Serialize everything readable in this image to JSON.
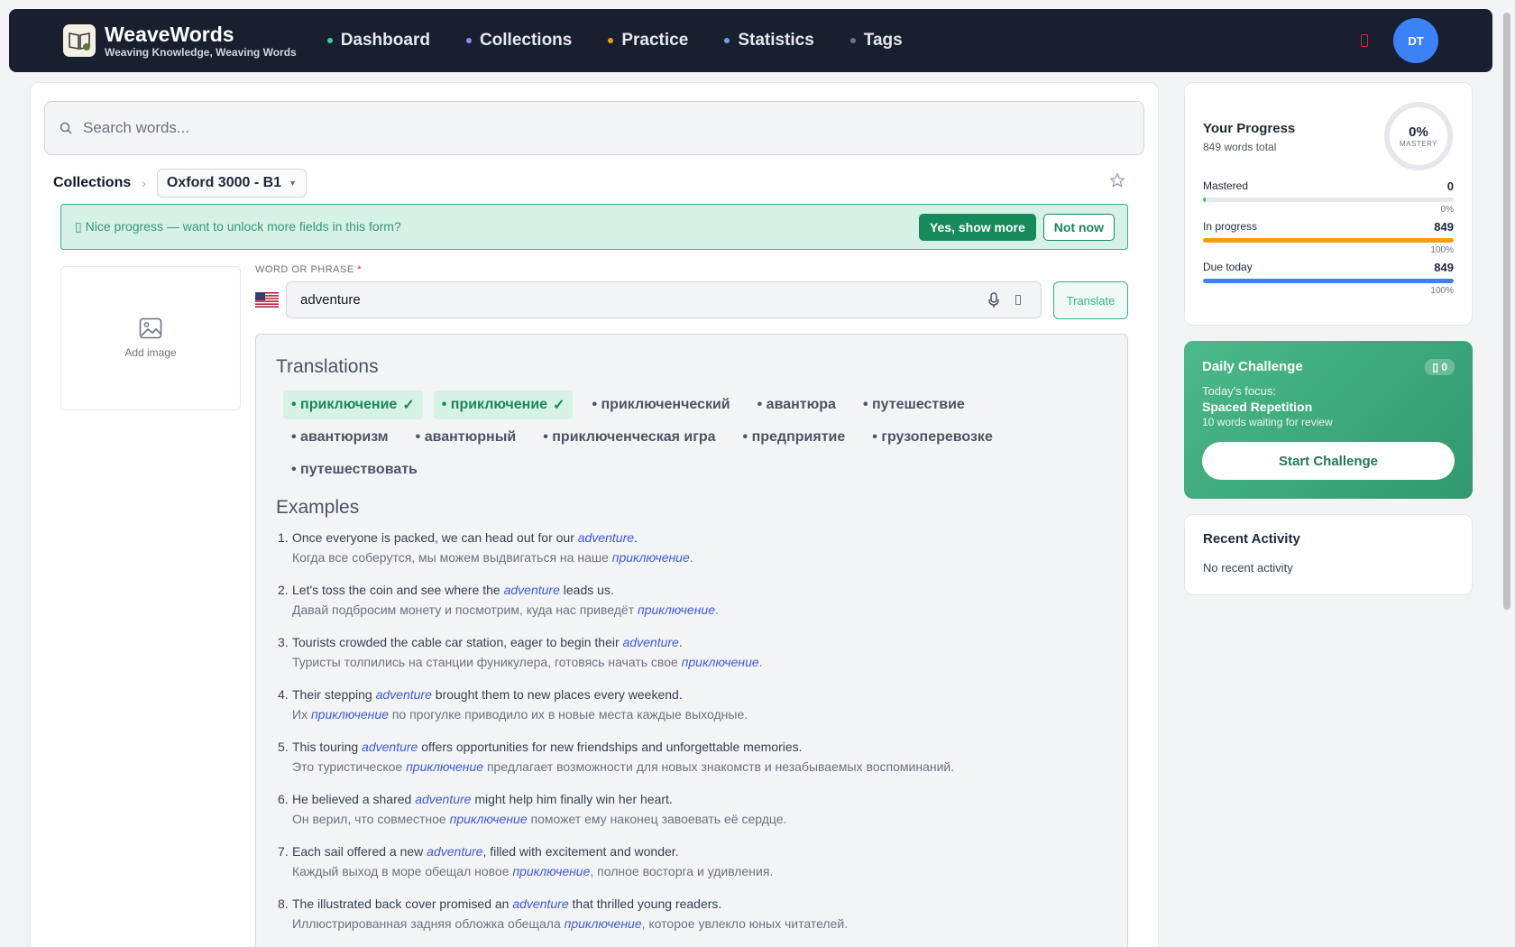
{
  "brand": {
    "name": "WeaveWords",
    "tagline": "Weaving Knowledge, Weaving Words"
  },
  "nav": [
    {
      "label": "Dashboard",
      "dot": "#34d399"
    },
    {
      "label": "Collections",
      "dot": "#818cf8"
    },
    {
      "label": "Practice",
      "dot": "#f59e0b"
    },
    {
      "label": "Statistics",
      "dot": "#60a5fa"
    },
    {
      "label": "Tags",
      "dot": "#6b7280"
    }
  ],
  "user": {
    "initials": "DT"
  },
  "search": {
    "placeholder": "Search words..."
  },
  "breadcrumb": {
    "root": "Collections",
    "current": "Oxford 3000 - B1"
  },
  "banner": {
    "message": "▯ Nice progress — want to unlock more fields in this form?",
    "yes": "Yes, show more",
    "no": "Not now"
  },
  "image": {
    "label": "Add image"
  },
  "word": {
    "label": "WORD OR PHRASE",
    "required": "*",
    "value": "adventure",
    "translate": "Translate"
  },
  "translations": {
    "title": "Translations",
    "items": [
      {
        "text": "• приключение",
        "selected": true
      },
      {
        "text": "• приключение",
        "selected": true
      },
      {
        "text": "• приключенческий",
        "selected": false
      },
      {
        "text": "• авантюра",
        "selected": false
      },
      {
        "text": "• путешествие",
        "selected": false
      },
      {
        "text": "• авантюризм",
        "selected": false
      },
      {
        "text": "• авантюрный",
        "selected": false
      },
      {
        "text": "• приключенческая игра",
        "selected": false
      },
      {
        "text": "• предприятие",
        "selected": false
      },
      {
        "text": "• грузоперевозке",
        "selected": false
      },
      {
        "text": "• путешествовать",
        "selected": false
      }
    ]
  },
  "examples": {
    "title": "Examples",
    "items": [
      {
        "n": "1.",
        "en": [
          "Once everyone is packed, we can head out for our ",
          "adventure",
          "."
        ],
        "ru": [
          "Когда все соберутся, мы можем выдвигаться на наше ",
          "приключение",
          "."
        ]
      },
      {
        "n": "2.",
        "en": [
          "Let's toss the coin and see where the ",
          "adventure",
          " leads us."
        ],
        "ru": [
          "Давай подбросим монету и посмотрим, куда нас приведёт ",
          "приключение",
          "."
        ]
      },
      {
        "n": "3.",
        "en": [
          "Tourists crowded the cable car station, eager to begin their ",
          "adventure",
          "."
        ],
        "ru": [
          "Туристы толпились на станции фуникулера, готовясь начать свое ",
          "приключение",
          "."
        ]
      },
      {
        "n": "4.",
        "en": [
          "Their stepping ",
          "adventure",
          " brought them to new places every weekend."
        ],
        "ru": [
          "Их ",
          "приключение",
          " по прогулке приводило их в новые места каждые выходные."
        ]
      },
      {
        "n": "5.",
        "en": [
          "This touring ",
          "adventure",
          " offers opportunities for new friendships and unforgettable memories."
        ],
        "ru": [
          "Это туристическое ",
          "приключение",
          " предлагает возможности для новых знакомств и незабываемых воспоминаний."
        ]
      },
      {
        "n": "6.",
        "en": [
          "He believed a shared ",
          "adventure",
          " might help him finally win her heart."
        ],
        "ru": [
          "Он верил, что совместное ",
          "приключение",
          " поможет ему наконец завоевать её сердце."
        ]
      },
      {
        "n": "7.",
        "en": [
          "Each sail offered a new ",
          "adventure",
          ", filled with excitement and wonder."
        ],
        "ru": [
          "Каждый выход в море обещал новое ",
          "приключение",
          ", полное восторга и удивления."
        ]
      },
      {
        "n": "8.",
        "en": [
          "The illustrated back cover promised an ",
          "adventure",
          " that thrilled young readers."
        ],
        "ru": [
          "Иллюстрированная задняя обложка обещала ",
          "приключение",
          ", которое увлекло юных читателей."
        ]
      }
    ]
  },
  "progress": {
    "title": "Your Progress",
    "subtitle": "849 words total",
    "mastery_pct": "0%",
    "mastery_label": "MASTERY",
    "stats": [
      {
        "label": "Mastered",
        "value": "0",
        "pct_label": "0%",
        "fraction": 0.01,
        "color": "#22c55e"
      },
      {
        "label": "In progress",
        "value": "849",
        "pct_label": "100%",
        "fraction": 1.0,
        "color": "#f59e0b"
      },
      {
        "label": "Due today",
        "value": "849",
        "pct_label": "100%",
        "fraction": 1.0,
        "color": "#3b82f6"
      }
    ]
  },
  "challenge": {
    "title": "Daily Challenge",
    "badge": "▯ 0",
    "focus_label": "Today's focus:",
    "focus": "Spaced Repetition",
    "detail": "10 words waiting for review",
    "button": "Start Challenge"
  },
  "activity": {
    "title": "Recent Activity",
    "empty": "No recent activity"
  }
}
